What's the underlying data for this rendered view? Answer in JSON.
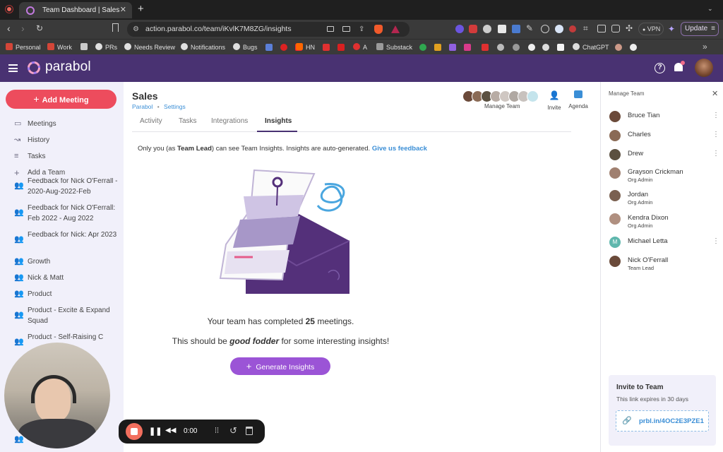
{
  "browser": {
    "tab_title": "Team Dashboard | Sales",
    "new_tab_glyph": "+",
    "url": "action.parabol.co/team/iKvlK7M8ZG/insights",
    "vpn_label": "VPN",
    "update_label": "Update"
  },
  "bookmarks": [
    {
      "label": "Personal",
      "icon": "gmail-icon",
      "color": "#d44638"
    },
    {
      "label": "Work",
      "icon": "gmail-icon",
      "color": "#d44638"
    },
    {
      "label": "",
      "icon": "trello-icon",
      "color": "#cccccc"
    },
    {
      "label": "PRs",
      "icon": "github-icon",
      "color": "#e0e0e0"
    },
    {
      "label": "Needs Review",
      "icon": "github-icon",
      "color": "#e0e0e0"
    },
    {
      "label": "Notifications",
      "icon": "github-icon",
      "color": "#e0e0e0"
    },
    {
      "label": "Bugs",
      "icon": "github-icon",
      "color": "#e0e0e0"
    },
    {
      "label": "HN",
      "icon": "hn-icon",
      "color": "#ff6600"
    },
    {
      "label": "A",
      "icon": "a-icon",
      "color": "#e03030"
    },
    {
      "label": "Substack",
      "icon": "folder-icon",
      "color": "#9a9a9a"
    },
    {
      "label": "ChatGPT",
      "icon": "chatgpt-icon",
      "color": "#dddddd"
    }
  ],
  "app": {
    "brand": "parabol",
    "help_icon": "help-icon",
    "notifications_icon": "bell-icon"
  },
  "sidebar": {
    "add_meeting_label": "Add Meeting",
    "items": [
      {
        "label": "Meetings",
        "icon": "meetings-icon"
      },
      {
        "label": "History",
        "icon": "history-icon"
      },
      {
        "label": "Tasks",
        "icon": "tasks-icon"
      },
      {
        "label": "Add a Team",
        "icon": "plus-icon"
      }
    ],
    "teams": [
      {
        "label": "Feedback for Nick O'Ferrall - 2020-Aug-2022-Feb"
      },
      {
        "label": "Feedback for Nick O'Ferrall: Feb 2022 - Aug 2022"
      },
      {
        "label": "Feedback for Nick: Apr 2023"
      },
      {
        "label": "Growth"
      },
      {
        "label": "Nick & Matt"
      },
      {
        "label": "Product"
      },
      {
        "label": "Product - Excite & Expand Squad"
      },
      {
        "label": "Product - Self-Raising C"
      }
    ]
  },
  "team": {
    "name": "Sales",
    "org": "Parabol",
    "separator": "•",
    "settings": "Settings",
    "manage_team_label": "Manage Team",
    "invite_label": "Invite",
    "agenda_label": "Agenda",
    "tabs": [
      "Activity",
      "Tasks",
      "Integrations",
      "Insights"
    ],
    "active_tab": "Insights"
  },
  "insights": {
    "notice_pre": "Only you (as ",
    "notice_role": "Team Lead",
    "notice_post": ") can see Team Insights. Insights are auto-generated.",
    "feedback_link": "Give us feedback",
    "completed_pre": "Your team has completed ",
    "completed_count": "25",
    "completed_post": " meetings.",
    "fodder_pre": "This should be ",
    "fodder_em": "good fodder",
    "fodder_post": " for some interesting insights!",
    "generate_label": "Generate Insights"
  },
  "manage_team": {
    "title": "Manage Team",
    "members": [
      {
        "name": "Bruce Tian",
        "role": "",
        "kebab": true,
        "avatar": "#6b4a3a"
      },
      {
        "name": "Charles",
        "role": "",
        "kebab": true,
        "avatar": "#8a6a55"
      },
      {
        "name": "Drew",
        "role": "",
        "kebab": true,
        "avatar": "#5b5040"
      },
      {
        "name": "Grayson Crickman",
        "role": "Org Admin",
        "kebab": false,
        "avatar": "#a08070"
      },
      {
        "name": "Jordan",
        "role": "Org Admin",
        "kebab": false,
        "avatar": "#7a6050"
      },
      {
        "name": "Kendra Dixon",
        "role": "Org Admin",
        "kebab": false,
        "avatar": "#b09080"
      },
      {
        "name": "Michael Letta",
        "role": "",
        "kebab": true,
        "avatar": "#5fb7ad",
        "initial": "M"
      },
      {
        "name": "Nick O'Ferrall",
        "role": "Team Lead",
        "kebab": false,
        "avatar": "#6a4a3a"
      }
    ],
    "invite_title": "Invite to Team",
    "invite_expiry": "This link expires in 30 days",
    "invite_link": "prbl.in/4OC2E3PZE1"
  },
  "recorder": {
    "time": "0:00"
  },
  "colors": {
    "appbar": "#493272",
    "add_meeting": "#ed4c5d",
    "generate": "#9b54d6",
    "link": "#3a8ed6",
    "active_tab": "#493272"
  }
}
